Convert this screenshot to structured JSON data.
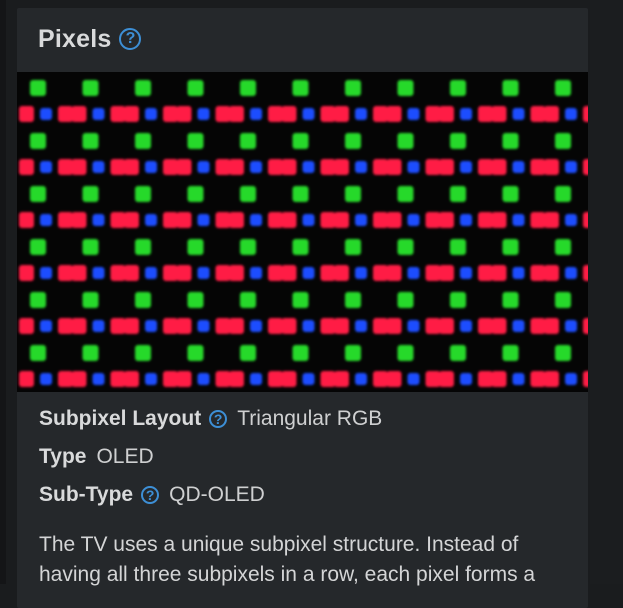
{
  "section": {
    "title": "Pixels",
    "help_icon": "question-circle-icon",
    "image_alt": "subpixel-macro-photo"
  },
  "colors": {
    "accent": "#3d8fd6",
    "card_bg": "#25282b",
    "page_bg": "#1a1c1e",
    "subpixel_green": "#27d92a",
    "subpixel_red": "#ff1f45",
    "subpixel_blue": "#1f4dff"
  },
  "specs": [
    {
      "label": "Subpixel Layout",
      "has_help": true,
      "value": "Triangular RGB"
    },
    {
      "label": "Type",
      "has_help": false,
      "value": "OLED"
    },
    {
      "label": "Sub-Type",
      "has_help": true,
      "value": "QD-OLED"
    }
  ],
  "description": "The TV uses a unique subpixel structure. Instead of having all three subpixels in a row, each pixel forms a"
}
